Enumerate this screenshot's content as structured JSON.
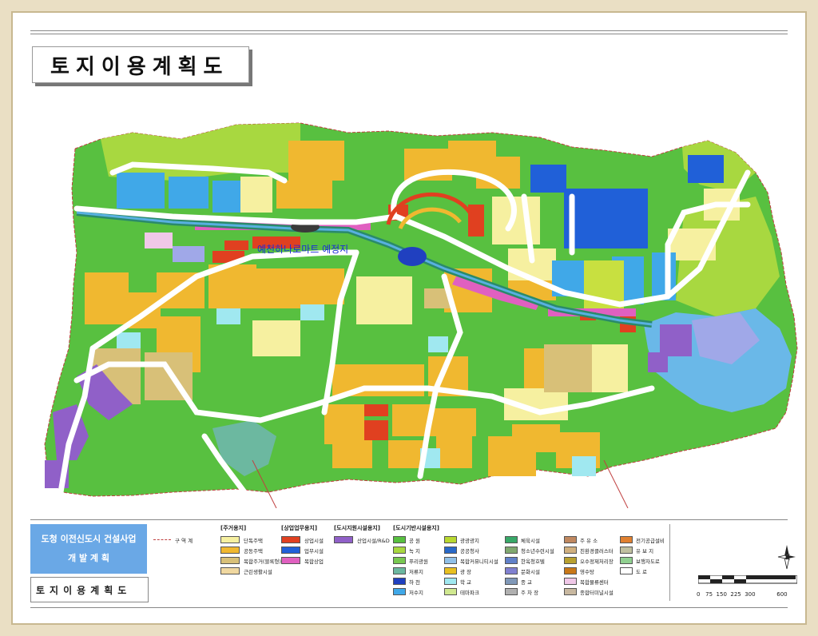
{
  "title": "토지이용계획도",
  "overlay_label": "예천하나로마트 예정지",
  "project_panel": {
    "line1": "도청 이전신도시 건설사업",
    "line2": "개 발 계 획",
    "bottom": "토지이용계획도"
  },
  "legend": {
    "boundary_label": "구 역 계",
    "residential": {
      "heading": "[주거용지]",
      "items": [
        {
          "label": "단독주택",
          "color": "#f6f0a0"
        },
        {
          "label": "공동주택",
          "color": "#f0b830"
        },
        {
          "label": "복합주거(블록형)",
          "color": "#d8c078"
        },
        {
          "label": "근린생활시설",
          "color": "#f0d8a0"
        }
      ]
    },
    "commercial": {
      "heading": "[상업업무용지]",
      "items": [
        {
          "label": "상업시설",
          "color": "#e04020"
        },
        {
          "label": "업무시설",
          "color": "#2060d8"
        },
        {
          "label": "복합상업",
          "color": "#e060c0"
        }
      ]
    },
    "support": {
      "heading": "[도시지원시설용지]",
      "items": [
        {
          "label": "산업시설/R&D",
          "color": "#9060c8"
        }
      ]
    },
    "infra": {
      "heading": "[도시기반시설용지]",
      "col1": [
        {
          "label": "공 원",
          "color": "#58c040"
        },
        {
          "label": "녹 지",
          "color": "#a8d840"
        },
        {
          "label": "푸리광원",
          "color": "#78c850"
        },
        {
          "label": "저류지",
          "color": "#6cb8a0"
        },
        {
          "label": "하 천",
          "color": "#2040c0"
        },
        {
          "label": "저수지",
          "color": "#40a8e8"
        }
      ],
      "col2": [
        {
          "label": "광광광지",
          "color": "#b8d830"
        },
        {
          "label": "공공청사",
          "color": "#2868c8"
        },
        {
          "label": "복합커뮤니티시설",
          "color": "#90c0e8"
        },
        {
          "label": "광 장",
          "color": "#e8c020"
        },
        {
          "label": "학 교",
          "color": "#a0e8f0"
        },
        {
          "label": "테마파크",
          "color": "#d0e890"
        }
      ],
      "col3": [
        {
          "label": "체육시설",
          "color": "#38a868"
        },
        {
          "label": "청소년수련시설",
          "color": "#80a870"
        },
        {
          "label": "한옥청호텔",
          "color": "#6080c8"
        },
        {
          "label": "문화시설",
          "color": "#8080d0"
        },
        {
          "label": "종 교",
          "color": "#8098b8"
        },
        {
          "label": "주 차 장",
          "color": "#b0b0b0"
        }
      ],
      "col4": [
        {
          "label": "주 유 소",
          "color": "#c08860"
        },
        {
          "label": "친환경클러스터",
          "color": "#d0b080"
        },
        {
          "label": "오수정제처리장",
          "color": "#b8a030"
        },
        {
          "label": "영수탕",
          "color": "#c87818"
        },
        {
          "label": "복합물류센터",
          "color": "#f0c8e8"
        },
        {
          "label": "종합터미널시설",
          "color": "#c8b8a0"
        }
      ],
      "col5": [
        {
          "label": "전기공급설비",
          "color": "#e08030"
        },
        {
          "label": "유 보 지",
          "color": "#c0c0a0"
        },
        {
          "label": "보행자도로",
          "color": "#90d090"
        },
        {
          "label": "도 로",
          "color": "#ffffff"
        }
      ]
    }
  },
  "scale": {
    "labels": [
      "0",
      "75",
      "150",
      "225",
      "300",
      "600"
    ]
  },
  "map_colors": {
    "park_green": "#58c040",
    "buffer_green": "#a8d840",
    "apartment_orange": "#f0b830",
    "detached_yellow": "#f6f0a0",
    "business_blue": "#2060d8",
    "commercial_red": "#e04020",
    "school_cyan": "#a0e8f0",
    "lake_blue": "#6ab8e8",
    "industrial_purple": "#9060c8",
    "mixed_pink": "#e060c0",
    "tan": "#d8c078",
    "road": "#ffffff",
    "river": "#2040c0"
  }
}
